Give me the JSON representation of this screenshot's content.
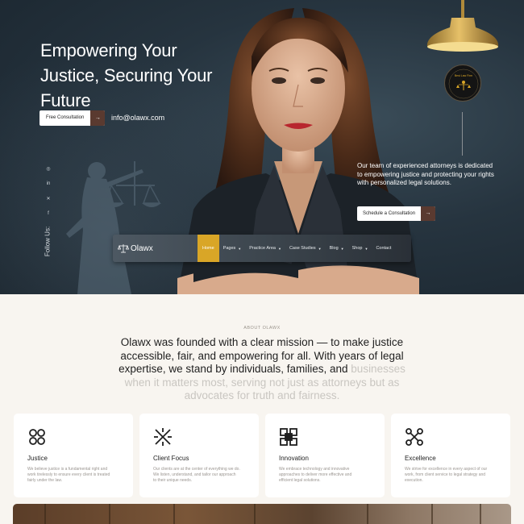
{
  "hero": {
    "title": "Empowering Your Justice, Securing Your Future",
    "consult_button": "Free Consultation",
    "email": "info@olawx.com",
    "follow_label": "Follow Us:",
    "social_icons": [
      "instagram-icon",
      "linkedin-icon",
      "x-icon",
      "facebook-icon"
    ],
    "description": "Our team of experienced attorneys is dedicated to empowering justice and protecting your rights with personalized legal solutions.",
    "schedule_button": "Schedule a Consultation",
    "badge_text": "Best Law Firm"
  },
  "nav": {
    "brand": "Olawx",
    "items": [
      {
        "label": "Home",
        "active": true,
        "dropdown": false
      },
      {
        "label": "Pages",
        "active": false,
        "dropdown": true
      },
      {
        "label": "Practice Area",
        "active": false,
        "dropdown": true
      },
      {
        "label": "Case Studies",
        "active": false,
        "dropdown": true
      },
      {
        "label": "Blog",
        "active": false,
        "dropdown": true
      },
      {
        "label": "Shop",
        "active": false,
        "dropdown": true
      },
      {
        "label": "Contact",
        "active": false,
        "dropdown": false
      }
    ],
    "accent_color": "#d9a627"
  },
  "about": {
    "label": "ABOUT OLAWX",
    "text_dark": "Olawx was founded with a clear mission — to make justice accessible, fair, and empowering for all. With years of legal expertise, we stand by individuals, families, and ",
    "text_faded": "businesses when it matters most, serving not just as attorneys but as advocates for truth and fairness."
  },
  "cards": [
    {
      "title": "Justice",
      "icon": "justice-icon",
      "desc": "We believe justice is a fundamental right and work tirelessly to ensure every client is treated fairly under the law."
    },
    {
      "title": "Client Focus",
      "icon": "client-focus-icon",
      "desc": "Our clients are at the center of everything we do. We listen, understand, and tailor our approach to their unique needs."
    },
    {
      "title": "Innovation",
      "icon": "innovation-icon",
      "desc": "We embrace technology and innovative approaches to deliver more effective and efficient legal solutions."
    },
    {
      "title": "Excellence",
      "icon": "excellence-icon",
      "desc": "We strive for excellence in every aspect of our work, from client service to legal strategy and execution."
    }
  ]
}
